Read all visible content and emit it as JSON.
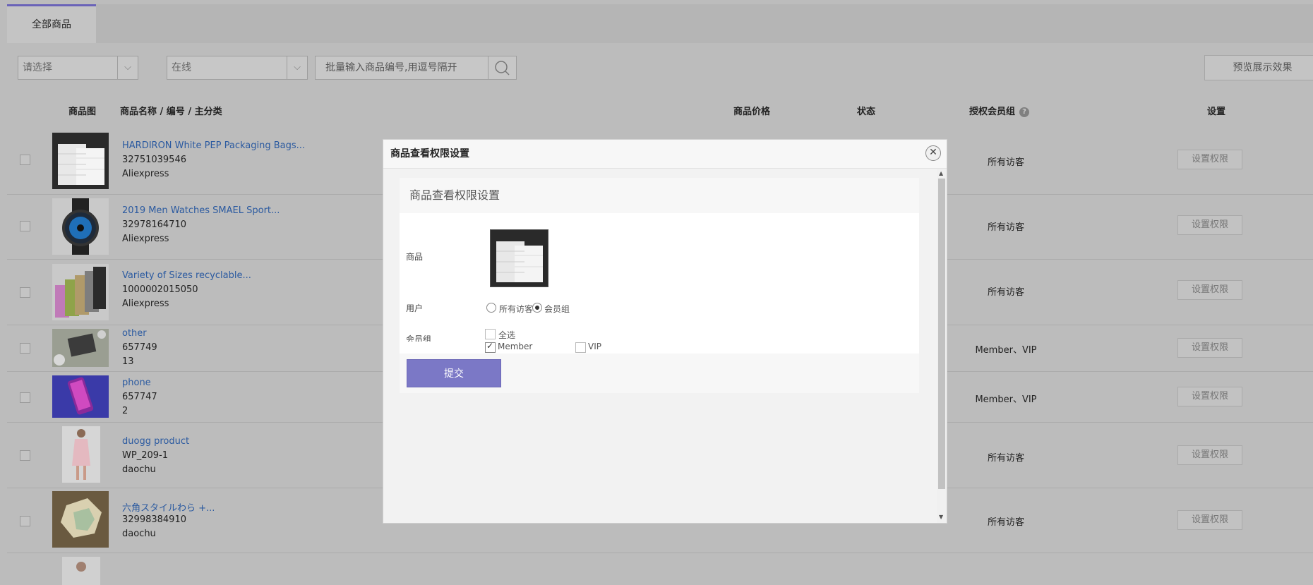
{
  "tabs": {
    "active": "全部商品"
  },
  "filters": {
    "category_select": "请选择",
    "status_select": "在线",
    "search_placeholder": "批量输入商品编号,用逗号隔开",
    "preview_button": "预览展示效果"
  },
  "table": {
    "headers": {
      "image": "商品图",
      "name": "商品名称 / 编号 / 主分类",
      "price": "商品价格",
      "status": "状态",
      "group": "授权会员组",
      "settings": "设置"
    },
    "rows": [
      {
        "name": "HARDIRON White PEP Packaging Bags...",
        "number": "32751039546",
        "category": "Aliexpress",
        "group": "所有访客",
        "action": "设置权限"
      },
      {
        "name": "2019 Men Watches SMAEL Sport...",
        "number": "32978164710",
        "category": "Aliexpress",
        "group": "所有访客",
        "action": "设置权限"
      },
      {
        "name": "Variety of Sizes recyclable...",
        "number": "1000002015050",
        "category": "Aliexpress",
        "group": "所有访客",
        "action": "设置权限"
      },
      {
        "name": "other",
        "number": "657749",
        "category": "13",
        "group": "Member、VIP",
        "action": "设置权限"
      },
      {
        "name": "phone",
        "number": "657747",
        "category": "2",
        "group": "Member、VIP",
        "action": "设置权限"
      },
      {
        "name": "duogg product",
        "number": "WP_209-1",
        "category": "daochu",
        "group": "所有访客",
        "action": "设置权限"
      },
      {
        "name": "六角スタイルわら +...",
        "number": "32998384910",
        "category": "daochu",
        "group": "所有访客",
        "action": "设置权限"
      }
    ]
  },
  "modal": {
    "title": "商品查看权限设置",
    "card_title": "商品查看权限设置",
    "product_label": "商品",
    "user_label": "用户",
    "user_options": [
      "所有访客",
      "会员组"
    ],
    "user_selected": "会员组",
    "group_label": "会员组",
    "select_all": "全选",
    "groups": [
      {
        "name": "Member",
        "checked": true
      },
      {
        "name": "VIP",
        "checked": false
      }
    ],
    "submit": "提交"
  }
}
